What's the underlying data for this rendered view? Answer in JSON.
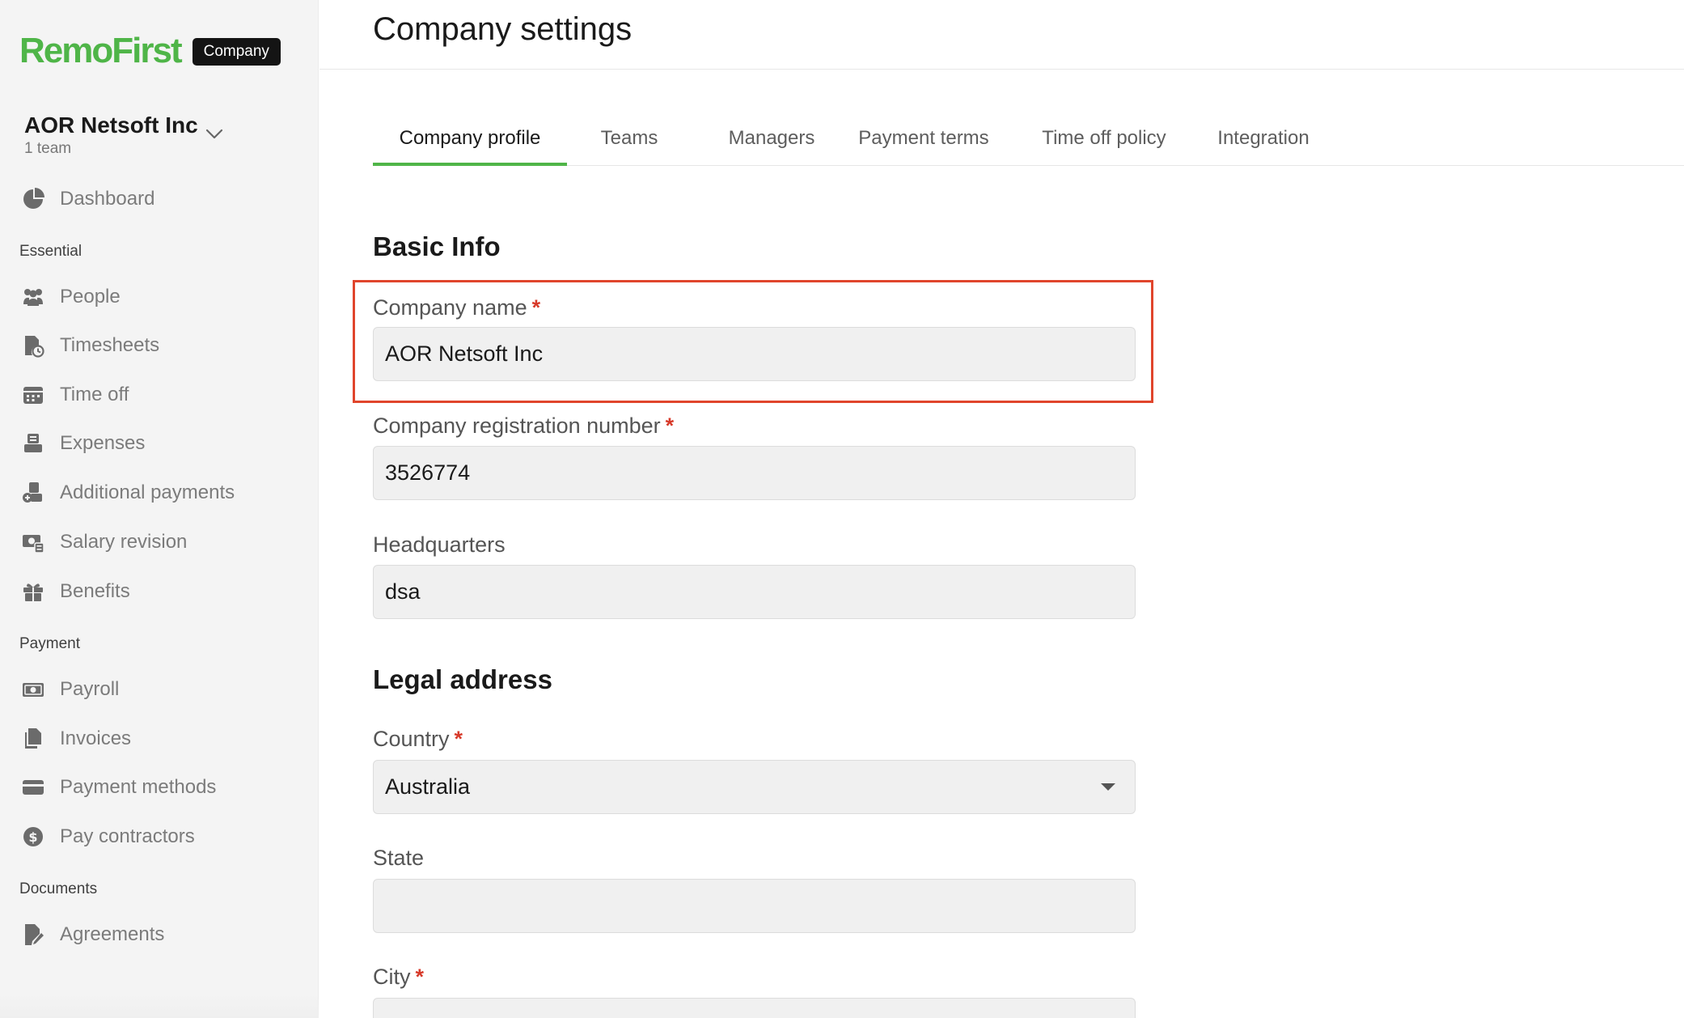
{
  "brand": {
    "logo": "RemoFirst",
    "badge": "Company"
  },
  "team": {
    "name": "AOR Netsoft Inc",
    "count": "1 team"
  },
  "sidebar": {
    "dashboard": "Dashboard",
    "sections": {
      "essential": "Essential",
      "payment": "Payment",
      "documents": "Documents"
    },
    "items": {
      "people": "People",
      "timesheets": "Timesheets",
      "time_off": "Time off",
      "expenses": "Expenses",
      "additional_payments": "Additional payments",
      "salary_revision": "Salary revision",
      "benefits": "Benefits",
      "payroll": "Payroll",
      "invoices": "Invoices",
      "payment_methods": "Payment methods",
      "pay_contractors": "Pay contractors",
      "agreements": "Agreements"
    }
  },
  "header": {
    "title": "Company settings"
  },
  "tabs": {
    "company_profile": "Company profile",
    "teams": "Teams",
    "managers": "Managers",
    "payment_terms": "Payment terms",
    "time_off_policy": "Time off policy",
    "integration": "Integration",
    "active": "company_profile"
  },
  "form": {
    "basic_info_title": "Basic Info",
    "company_name": {
      "label": "Company name",
      "value": "AOR Netsoft Inc",
      "required_mark": "*"
    },
    "registration": {
      "label": "Company registration number",
      "value": "3526774",
      "required_mark": "*"
    },
    "headquarters": {
      "label": "Headquarters",
      "value": "dsa"
    },
    "legal_address_title": "Legal address",
    "country": {
      "label": "Country",
      "value": "Australia",
      "required_mark": "*"
    },
    "state": {
      "label": "State",
      "value": ""
    },
    "city": {
      "label": "City",
      "required_mark": "*"
    }
  },
  "colors": {
    "brand_green": "#4fb548",
    "highlight_red": "#e0452c",
    "required_red": "#d73a2a"
  }
}
